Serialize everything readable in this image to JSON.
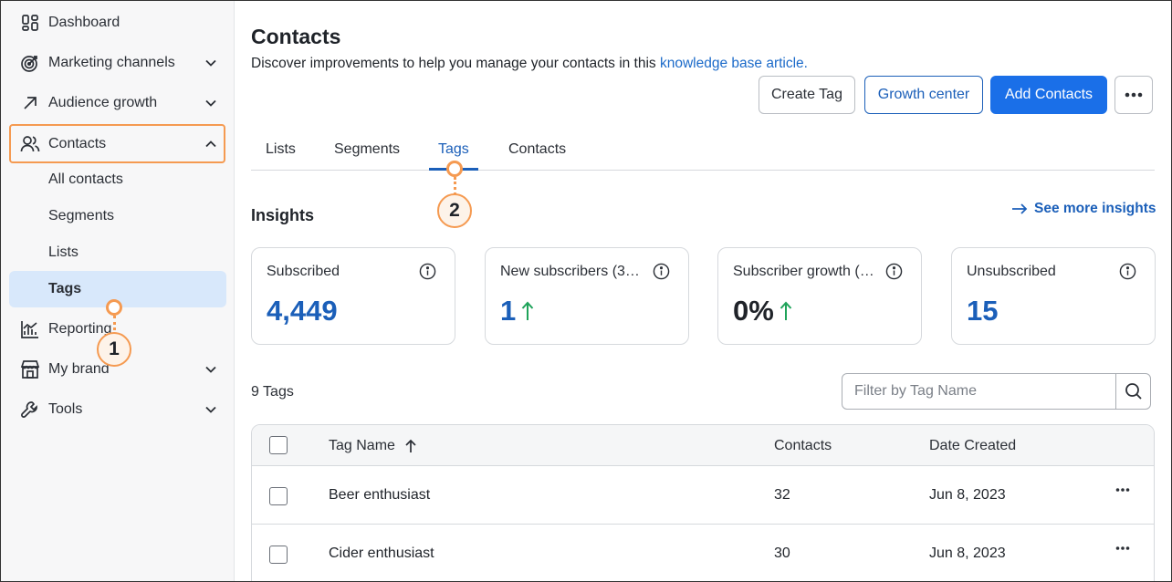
{
  "sidebar": {
    "items": [
      {
        "label": "Dashboard",
        "icon": "dashboard-icon"
      },
      {
        "label": "Marketing channels",
        "icon": "target-icon"
      },
      {
        "label": "Audience growth",
        "icon": "arrow-up-right-icon"
      },
      {
        "label": "Contacts",
        "icon": "people-icon"
      },
      {
        "label": "Reporting",
        "icon": "chart-icon"
      },
      {
        "label": "My brand",
        "icon": "storefront-icon"
      },
      {
        "label": "Tools",
        "icon": "wrench-icon"
      }
    ],
    "contacts_sub": [
      "All contacts",
      "Segments",
      "Lists",
      "Tags"
    ],
    "selected_sub": "Tags"
  },
  "header": {
    "title": "Contacts",
    "subtitle_prefix": "Discover improvements to help you manage your contacts in this ",
    "subtitle_link": "knowledge base article."
  },
  "toolbar": {
    "create_tag": "Create Tag",
    "growth_center": "Growth center",
    "add_contacts": "Add Contacts",
    "more_icon": "ellipsis-icon"
  },
  "tabs": [
    {
      "label": "Lists"
    },
    {
      "label": "Segments"
    },
    {
      "label": "Tags"
    },
    {
      "label": "Contacts"
    }
  ],
  "active_tab": "Tags",
  "insights": {
    "title": "Insights",
    "see_more": "See more insights",
    "cards": [
      {
        "title": "Subscribed",
        "value": "4,449"
      },
      {
        "title": "New subscribers (3…",
        "value": "1"
      },
      {
        "title": "Subscriber growth (…",
        "value": "0%"
      },
      {
        "title": "Unsubscribed",
        "value": "15"
      }
    ]
  },
  "tags_section": {
    "count": "9 Tags",
    "filter_placeholder": "Filter by Tag Name"
  },
  "table": {
    "headers": {
      "name": "Tag Name",
      "contacts": "Contacts",
      "date": "Date Created"
    },
    "rows": [
      {
        "name": "Beer enthusiast",
        "contacts": "32",
        "date": "Jun 8, 2023"
      },
      {
        "name": "Cider enthusiast",
        "contacts": "30",
        "date": "Jun 8, 2023"
      }
    ]
  },
  "callouts": {
    "one": "1",
    "two": "2"
  },
  "colors": {
    "accent": "#1a6fe8",
    "link": "#1b5fb9",
    "highlight": "#f59a51",
    "selected_bg": "#d8e8fb",
    "growth_arrow": "#1fa35a"
  }
}
